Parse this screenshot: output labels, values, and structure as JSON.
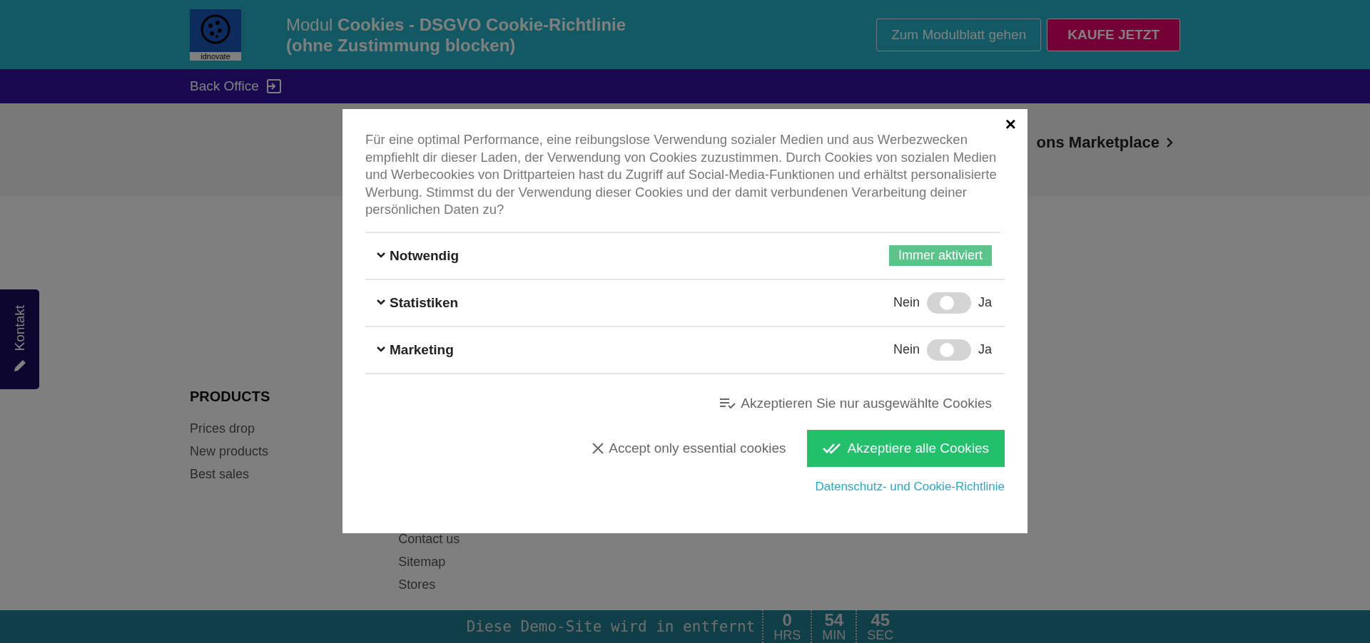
{
  "header": {
    "logo_text": "idnovate",
    "title": "Modul **Cookies - DSGVO Cookie-Richtlinie**",
    "subtitle": "(ohne Zustimmung blocken)",
    "buttons": [
      {
        "label": "Zum Modulblatt gehen",
        "kind": "outline"
      },
      {
        "label": "KAUFE JETZT",
        "kind": "primary"
      }
    ]
  },
  "nav": {
    "label": "Back Office"
  },
  "band": {
    "link": "ons Marketplace"
  },
  "side_tab": {
    "label": "Kontakt"
  },
  "footer_columns": [
    {
      "heading": "PRODUCTS",
      "links": [
        "Prices drop",
        "New products",
        "Best sales"
      ]
    },
    {
      "links": [
        "Contact us",
        "Sitemap",
        "Stores"
      ]
    }
  ],
  "demo_bar": {
    "text": "Diese Demo-Site wird in entfernt",
    "counters": [
      {
        "value": "0",
        "unit": "HRS"
      },
      {
        "value": "54",
        "unit": "MIN"
      },
      {
        "value": "45",
        "unit": "SEC"
      }
    ]
  },
  "modal": {
    "close": "×",
    "text": "Für eine optimal Performance, eine reibungslose Verwendung sozialer Medien und aus Werbezwecken empfiehlt dir dieser Laden, der Verwendung von Cookies zuzustimmen. Durch Cookies von sozialen Medien und Werbecookies von Drittparteien hast du Zugriff auf Social-Media-Funktionen und erhältst personalisierte Werbung. Stimmst du der Verwendung dieser Cookies und der damit verbundenen Verarbeitung deiner persönlichen Daten zu?",
    "categories": [
      {
        "name": "Notwendig",
        "kind": "badge",
        "badge": "Immer aktiviert"
      },
      {
        "name": "Statistiken",
        "kind": "toggle",
        "off_label": "Nein",
        "on_label": "Ja",
        "on": false
      },
      {
        "name": "Marketing",
        "kind": "toggle",
        "off_label": "Nein",
        "on_label": "Ja",
        "on": false
      }
    ],
    "accept_selected": "Akzeptieren Sie nur ausgewählte Cookies",
    "accept_essential": "Accept only essential cookies",
    "accept_all": "Akzeptiere alle Cookies",
    "policy_link": "Datenschutz- und Cookie-Richtlinie"
  }
}
